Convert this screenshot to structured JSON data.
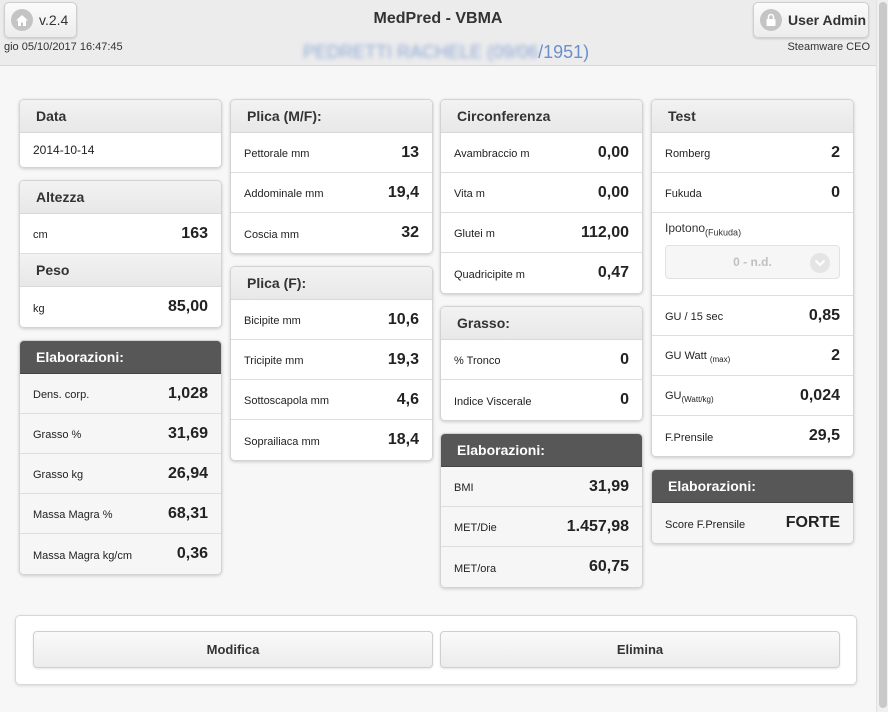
{
  "header": {
    "version_label": "v.2.4",
    "app_title": "MedPred - VBMA",
    "user_label": "User Admin",
    "datetime": "gio 05/10/2017 16:47:45",
    "company": "Steamware CEO",
    "patient_obscured": "PEDRETTI RACHELE (09/06",
    "patient_visible": "/1951)"
  },
  "data_panel": {
    "title": "Data",
    "value": "2014-10-14"
  },
  "altezza_panel": {
    "title": "Altezza",
    "unit": "cm",
    "value": "163"
  },
  "peso_panel": {
    "title": "Peso",
    "unit": "kg",
    "value": "85,00"
  },
  "elaborazioni1": {
    "title": "Elaborazioni:",
    "rows": [
      {
        "label": "Dens. corp.",
        "value": "1,028"
      },
      {
        "label": "Grasso %",
        "value": "31,69"
      },
      {
        "label": "Grasso kg",
        "value": "26,94"
      },
      {
        "label": "Massa Magra %",
        "value": "68,31"
      },
      {
        "label": "Massa Magra kg/cm",
        "value": "0,36"
      }
    ]
  },
  "plica_mf": {
    "title": "Plica (M/F):",
    "rows": [
      {
        "label": "Pettorale mm",
        "value": "13"
      },
      {
        "label": "Addominale mm",
        "value": "19,4"
      },
      {
        "label": "Coscia mm",
        "value": "32"
      }
    ]
  },
  "plica_f": {
    "title": "Plica (F):",
    "rows": [
      {
        "label": "Bicipite mm",
        "value": "10,6"
      },
      {
        "label": "Tricipite mm",
        "value": "19,3"
      },
      {
        "label": "Sottoscapola mm",
        "value": "4,6"
      },
      {
        "label": "Soprailiaca mm",
        "value": "18,4"
      }
    ]
  },
  "circonferenza": {
    "title": "Circonferenza",
    "rows": [
      {
        "label": "Avambraccio m",
        "value": "0,00"
      },
      {
        "label": "Vita m",
        "value": "0,00"
      },
      {
        "label": "Glutei m",
        "value": "112,00"
      },
      {
        "label": "Quadricipite m",
        "value": "0,47"
      }
    ]
  },
  "grasso": {
    "title": "Grasso:",
    "rows": [
      {
        "label": "% Tronco",
        "value": "0"
      },
      {
        "label": "Indice Viscerale",
        "value": "0"
      }
    ]
  },
  "elaborazioni2": {
    "title": "Elaborazioni:",
    "rows": [
      {
        "label": "BMI",
        "value": "31,99"
      },
      {
        "label": "MET/Die",
        "value": "1.457,98"
      },
      {
        "label": "MET/ora",
        "value": "60,75"
      }
    ]
  },
  "test": {
    "title": "Test",
    "romberg_label": "Romberg",
    "romberg_value": "2",
    "fukuda_label": "Fukuda",
    "fukuda_value": "0",
    "ipotono_label": "Ipotono",
    "ipotono_sub": "(Fukuda)",
    "ipotono_selected": "0 - n.d.",
    "gu15_label": "GU / 15 sec",
    "gu15_value": "0,85",
    "guwatt_label": "GU Watt",
    "guwatt_sub": "(max)",
    "guwatt_value": "2",
    "guwattkg_label": "GU",
    "guwattkg_sub": "(Watt/kg)",
    "guwattkg_value": "0,024",
    "fprensile_label": "F.Prensile",
    "fprensile_value": "29,5"
  },
  "elaborazioni3": {
    "title": "Elaborazioni:",
    "score_label": "Score F.Prensile",
    "score_value": "FORTE"
  },
  "footer": {
    "modifica_label": "Modifica",
    "elimina_label": "Elimina"
  }
}
